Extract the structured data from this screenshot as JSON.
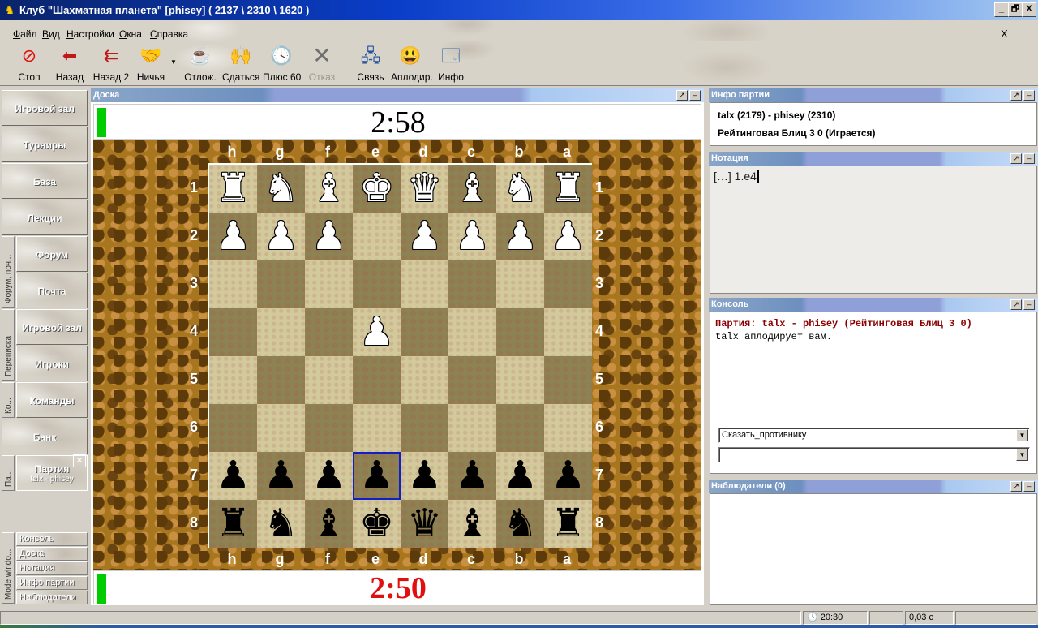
{
  "window": {
    "title": "Клуб \"Шахматная планета\" [phisey]  ( 2137 \\ 2310 \\ 1620 )",
    "icon": "chess-knight-icon",
    "minimize": "_",
    "maximize": "🗗",
    "close": "X"
  },
  "menu": {
    "items": [
      "Файл",
      "Вид",
      "Настройки",
      "Окна",
      "Справка"
    ],
    "close": "X"
  },
  "toolbar": {
    "buttons": [
      {
        "label": "Стоп",
        "icon": "stop-icon",
        "glyph": "⊘",
        "color": "#e01010"
      },
      {
        "label": "Назад",
        "icon": "back-arrow-icon",
        "glyph": "➡",
        "color": "#c01818"
      },
      {
        "label": "Назад 2",
        "icon": "double-back-icon",
        "glyph": "⇇",
        "color": "#c01818"
      },
      {
        "label": "Ничья",
        "icon": "handshake-icon",
        "glyph": "🤝",
        "color": "#c09020"
      },
      {
        "label": "Отлож.",
        "icon": "coffee-cup-icon",
        "glyph": "☕",
        "color": "#604020"
      },
      {
        "label": "Сдаться",
        "icon": "raised-hands-icon",
        "glyph": "🙌",
        "color": "#a08040"
      },
      {
        "label": "Плюс 60",
        "icon": "clock-icon",
        "glyph": "🕓",
        "color": "#303030"
      },
      {
        "label": "Отказ",
        "icon": "reject-x-icon",
        "glyph": "✕",
        "color": "#707070"
      },
      {
        "label": "Связь",
        "icon": "network-icon",
        "glyph": "🖧",
        "color": "#2050a0"
      },
      {
        "label": "Аплодир.",
        "icon": "smiley-icon",
        "glyph": "😃",
        "color": "#e0b000"
      },
      {
        "label": "Инфо",
        "icon": "info-card-icon",
        "glyph": "🗔",
        "color": "#4070b0"
      }
    ]
  },
  "sidebar": {
    "main": [
      "Игровой зал",
      "Турниры",
      "База",
      "Лекции"
    ],
    "forum_group_label": "Форум, поч...",
    "forum": [
      "Форум",
      "Почта"
    ],
    "corr_group_label": "Переписка",
    "corr": [
      "Игровой зал",
      "Игроки"
    ],
    "teams_group_label": "Ко...",
    "teams": [
      "Команды"
    ],
    "bank": "Банк",
    "game_group_label": "Па...",
    "game_title": "Партия",
    "game_subtitle": "talx - phisey",
    "game_close": "✕",
    "mode_label": "Mode windo...",
    "windows": [
      "Консоль",
      "Доска",
      "Нотация",
      "Инфо партии",
      "Наблюдатели"
    ]
  },
  "board": {
    "panel_title": "Доска",
    "top_clock": "2:58",
    "bottom_clock": "2:50",
    "bottom_clock_color": "#e01010",
    "files": [
      "h",
      "g",
      "f",
      "e",
      "d",
      "c",
      "b",
      "a"
    ],
    "ranks": [
      "1",
      "2",
      "3",
      "4",
      "5",
      "6",
      "7",
      "8"
    ],
    "rows": [
      [
        "wR",
        "wN",
        "wB",
        "wK",
        "wQ",
        "wB",
        "wN",
        "wR"
      ],
      [
        "wP",
        "wP",
        "wP",
        "",
        "wP",
        "wP",
        "wP",
        "wP"
      ],
      [
        "",
        "",
        "",
        "",
        "",
        "",
        "",
        ""
      ],
      [
        "",
        "",
        "",
        "wP",
        "",
        "",
        "",
        ""
      ],
      [
        "",
        "",
        "",
        "",
        "",
        "",
        "",
        ""
      ],
      [
        "",
        "",
        "",
        "",
        "",
        "",
        "",
        ""
      ],
      [
        "bP",
        "bP",
        "bP",
        "bP",
        "bP",
        "bP",
        "bP",
        "bP"
      ],
      [
        "bR",
        "bN",
        "bB",
        "bK",
        "bQ",
        "bB",
        "bN",
        "bR"
      ]
    ],
    "highlight": {
      "row": 6,
      "col": 3
    },
    "highlight_color": "#1020c8"
  },
  "game_info": {
    "panel_title": "Инфо партии",
    "players": "talx (2179) - phisey (2310)",
    "type": "Рейтинговая Блиц 3 0  (Играется)"
  },
  "notation": {
    "panel_title": "Нотация",
    "text": "[…] 1.e4"
  },
  "console": {
    "panel_title": "Консоль",
    "line1": "Партия: talx - phisey (Рейтинговая Блиц 3 0)",
    "line1_color": "#8b0000",
    "line2": "talx аплодирует вам.",
    "say_select": "Сказать_противнику",
    "input_value": ""
  },
  "observers": {
    "panel_title": "Наблюдатели (0)"
  },
  "statusbar": {
    "clock_icon": "clock-icon",
    "time": "20:30",
    "lag": "0,03 с"
  }
}
